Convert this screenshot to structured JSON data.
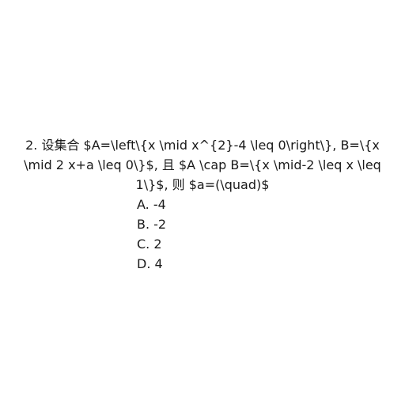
{
  "question": {
    "stem": "2. 设集合 $A=\\left\\{x \\mid x^{2}-4 \\leq 0\\right\\}, B=\\{x \\mid 2 x+a \\leq 0\\}$, 且 $A \\cap B=\\{x \\mid-2 \\leq x \\leq 1\\}$, 则 $a=(\\quad)$",
    "options": [
      "A. -4",
      "B. -2",
      "C. 2",
      "D. 4"
    ]
  }
}
